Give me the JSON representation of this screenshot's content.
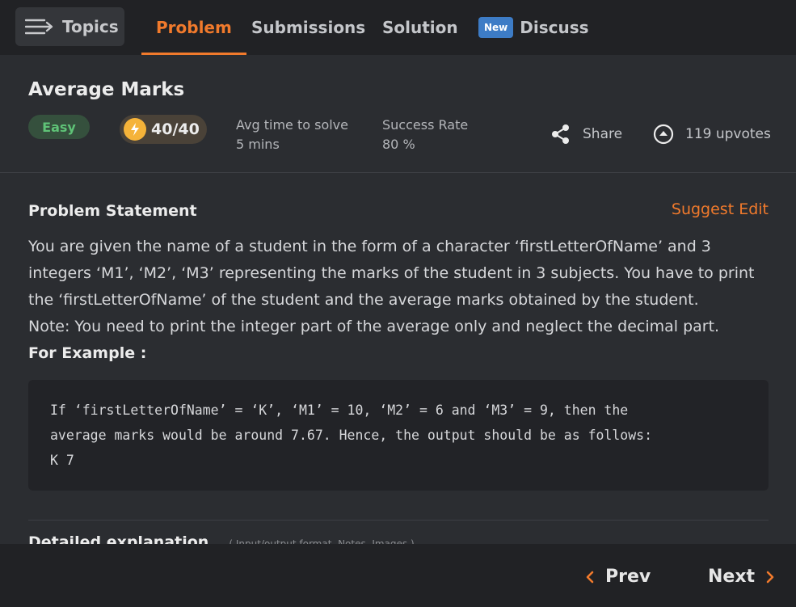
{
  "topbar": {
    "topics_label": "Topics",
    "tabs": [
      {
        "label": "Problem",
        "active": true
      },
      {
        "label": "Submissions",
        "active": false
      },
      {
        "label": "Solution",
        "active": false
      },
      {
        "label": "Discuss",
        "active": false,
        "badge": "New"
      }
    ]
  },
  "header": {
    "title": "Average Marks",
    "difficulty": "Easy",
    "score": "40/40",
    "avg_time_label": "Avg time to solve",
    "avg_time_value": "5 mins",
    "success_label": "Success Rate",
    "success_value": "80 %",
    "share_label": "Share",
    "upvotes_label": "119 upvotes"
  },
  "problem": {
    "heading": "Problem Statement",
    "suggest_edit": "Suggest Edit",
    "lines": [
      "You are given the name of a student in the form of a character ‘firstLetterOfName’ and 3",
      "integers ‘M1’, ‘M2’, ‘M3’ representing the marks of the student in 3 subjects. You have to print",
      "the ‘firstLetterOfName’ of the student and the average marks obtained by the student.",
      "Note: You need to print the integer part of the average only and neglect the decimal part."
    ],
    "example_heading": "For Example :",
    "code_lines": [
      "If ‘firstLetterOfName’ = ‘K’, ‘M1’ = 10, ‘M2’ = 6 and ‘M3’ = 9, then the",
      "average marks would be around 7.67. Hence, the output should be as follows:",
      "K 7"
    ],
    "next_section_heading": "Detailed explanation",
    "next_section_hint": "( Input/output format, Notes, Images )"
  },
  "footer": {
    "prev_label": "Prev",
    "next_label": "Next"
  },
  "colors": {
    "accent": "#f17a2c",
    "easy": "#5fc377",
    "badge": "#3d7cc6"
  }
}
